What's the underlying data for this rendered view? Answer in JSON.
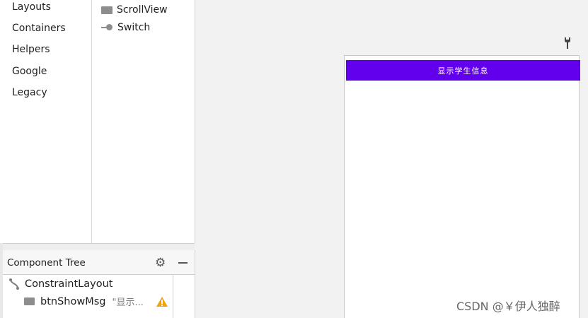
{
  "palette": {
    "categories": [
      "Layouts",
      "Containers",
      "Helpers",
      "Google",
      "Legacy"
    ],
    "components": [
      {
        "label": "ScrollView",
        "icon": "scrollview-icon"
      },
      {
        "label": "Switch",
        "icon": "switch-icon"
      }
    ]
  },
  "component_tree": {
    "title": "Component Tree",
    "nodes": [
      {
        "label": "ConstraintLayout",
        "icon": "constraint-layout-icon"
      },
      {
        "label": "btnShowMsg",
        "extra": "\"显示...",
        "icon": "button-icon",
        "warning": true
      }
    ]
  },
  "preview": {
    "button_text": "显示学生信息",
    "button_color": "#6200ee"
  },
  "watermark": "CSDN @￥伊人独醉",
  "colors": {
    "warning": "#f0a30a",
    "accent": "#6200ee"
  }
}
